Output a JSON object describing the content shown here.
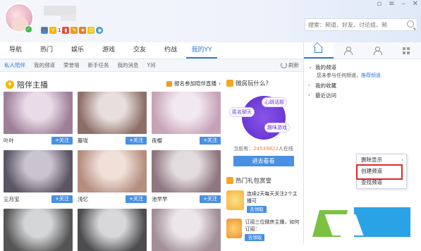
{
  "header": {
    "search_placeholder": "搜索：频道、好友、讨论组、频",
    "badge_count": "1"
  },
  "nav": {
    "tabs": [
      "导航",
      "热门",
      "娱乐",
      "游戏",
      "交友",
      "约战",
      "我的YY"
    ]
  },
  "subnav": {
    "items": [
      "私人陪伴",
      "我的频道",
      "荣誉墙",
      "新手任务",
      "我的消息",
      "Y间"
    ],
    "refresh": "刷新"
  },
  "anchors": {
    "title": "陪伴主播",
    "signup": "报名参加陪伴直播",
    "follow_label": "+关注",
    "cards": [
      {
        "name": "叶叶",
        "colors": [
          "#e9dbe8",
          "#9d7f98"
        ]
      },
      {
        "name": "藤珑",
        "colors": [
          "#e8dfdd",
          "#8d6f68"
        ]
      },
      {
        "name": "夜樱",
        "colors": [
          "#f2e8f0",
          "#c7a3b7"
        ]
      },
      {
        "name": "尘月宝",
        "colors": [
          "#c9c4cf",
          "#5a5563"
        ]
      },
      {
        "name": "浅忆",
        "colors": [
          "#f0e0d8",
          "#b58e80"
        ]
      },
      {
        "name": "池早早",
        "colors": [
          "#e3dcdf",
          "#8e7780"
        ]
      },
      {
        "name": "",
        "colors": [
          "#d5d6d8",
          "#555"
        ]
      },
      {
        "name": "",
        "colors": [
          "#d8d8da",
          "#4d4d4f"
        ]
      },
      {
        "name": "",
        "colors": [
          "#ece6ea",
          "#a28f98"
        ]
      }
    ]
  },
  "game_room": {
    "title": "微房玩什么？",
    "labels": [
      "匿名聊天",
      "心跳话题",
      "趣味游戏"
    ],
    "online_prefix": "当前有：",
    "online_value": "24539822",
    "online_suffix": "人在线",
    "enter_button": "进去看看"
  },
  "gifts": {
    "title": "热门礼包赏誉",
    "items": [
      {
        "text": "连续2天每天关注2个主播可",
        "button": "去领取"
      },
      {
        "text": "订阅三位微房主播，如何订阅：",
        "button": "去领取"
      }
    ]
  },
  "right_panel": {
    "tree": {
      "my_channels": "我的频道",
      "note_prefix": "您未参与任何频道，",
      "note_link": "推荐频道",
      "my_favorites": "我的收藏",
      "recent": "最近访问"
    },
    "context_menu": [
      "删除显示",
      "创建频道",
      "查找频道"
    ]
  }
}
